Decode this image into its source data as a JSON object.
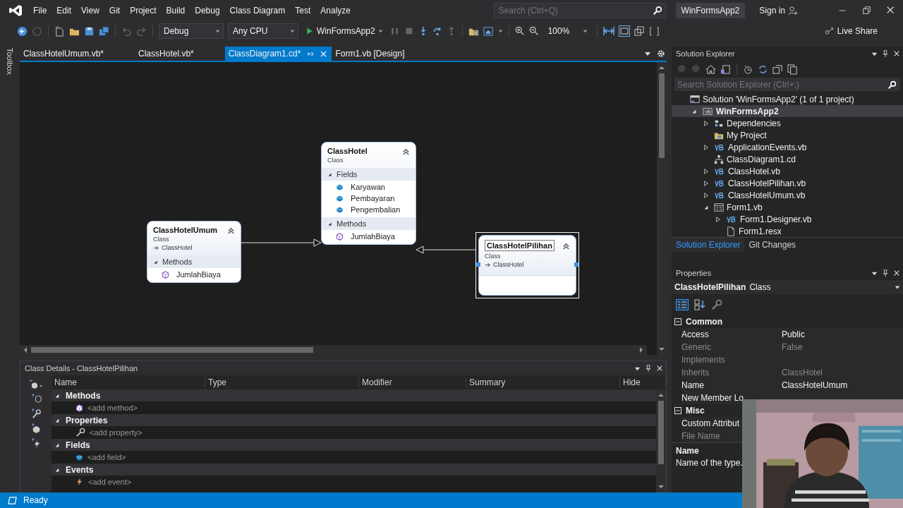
{
  "menu": [
    "File",
    "Edit",
    "View",
    "Git",
    "Project",
    "Build",
    "Debug",
    "Class Diagram",
    "Test",
    "Analyze"
  ],
  "search": {
    "placeholder": "Search (Ctrl+Q)"
  },
  "solution_name": "WinFormsApp2",
  "sign_in": "Sign in",
  "toolbar": {
    "configuration": "Debug",
    "platform": "Any CPU",
    "start_target": "WinFormsApp2",
    "zoom": "100%",
    "live_share": "Live Share"
  },
  "toolbox": "Toolbox",
  "tabs": [
    {
      "label": "ClassHotelUmum.vb*",
      "selected": false
    },
    {
      "label": "ClassHotel.vb*",
      "selected": false
    },
    {
      "label": "ClassDiagram1.cd*",
      "selected": true
    },
    {
      "label": "Form1.vb [Design]",
      "selected": false
    }
  ],
  "diagram": {
    "classes": [
      {
        "name": "ClassHotel",
        "stereotype": "Class",
        "selected": false,
        "compartments": [
          {
            "title": "Fields",
            "kind": "field",
            "expanded": true,
            "members": [
              "Karyawan",
              "Pembayaran",
              "Pengembalian"
            ]
          },
          {
            "title": "Methods",
            "kind": "method",
            "expanded": true,
            "members": [
              "JumlahBiaya"
            ]
          }
        ]
      },
      {
        "name": "ClassHotelUmum",
        "stereotype": "Class",
        "base": "ClassHotel",
        "selected": false,
        "compartments": [
          {
            "title": "Methods",
            "kind": "method",
            "expanded": true,
            "members": [
              "JumlahBiaya"
            ]
          }
        ]
      },
      {
        "name": "ClassHotelPilihan",
        "stereotype": "Class",
        "base": "ClassHotel",
        "selected": true
      }
    ]
  },
  "class_details": {
    "title": "Class Details - ClassHotelPilihan",
    "columns": [
      "Name",
      "Type",
      "Modifier",
      "Summary",
      "Hide"
    ],
    "groups": [
      {
        "title": "Methods",
        "kind": "method",
        "expanded": true,
        "add_row": "<add method>"
      },
      {
        "title": "Properties",
        "kind": "property",
        "expanded": true,
        "add_row": "<add property>"
      },
      {
        "title": "Fields",
        "kind": "field",
        "expanded": true,
        "add_row": "<add field>"
      },
      {
        "title": "Events",
        "kind": "event",
        "expanded": true,
        "add_row": "<add event>"
      }
    ]
  },
  "solution_explorer": {
    "title": "Solution Explorer",
    "search": {
      "placeholder": "Search Solution Explorer (Ctrl+;)"
    },
    "tree": [
      {
        "label": "Solution 'WinFormsApp2' (1 of 1 project)",
        "kind": "solution",
        "selected": false,
        "children": [
          {
            "label": "WinFormsApp2",
            "kind": "startup_project",
            "selected": true,
            "expanded": true,
            "children": [
              {
                "label": "Dependencies",
                "kind": "dependencies",
                "selected": false,
                "expanded": false
              },
              {
                "label": "My Project",
                "kind": "my_project",
                "selected": false
              },
              {
                "label": "ApplicationEvents.vb",
                "kind": "vb",
                "selected": false,
                "expanded": false
              },
              {
                "label": "ClassDiagram1.cd",
                "kind": "diagram",
                "selected": false
              },
              {
                "label": "ClassHotel.vb",
                "kind": "vb",
                "selected": false,
                "expanded": false
              },
              {
                "label": "ClassHotelPilihan.vb",
                "kind": "vb",
                "selected": false,
                "expanded": false
              },
              {
                "label": "ClassHotelUmum.vb",
                "kind": "vb",
                "selected": false,
                "expanded": false
              },
              {
                "label": "Form1.vb",
                "kind": "form",
                "selected": false,
                "expanded": true,
                "children": [
                  {
                    "label": "Form1.Designer.vb",
                    "kind": "vb",
                    "selected": false,
                    "expanded": false
                  },
                  {
                    "label": "Form1.resx",
                    "kind": "resource",
                    "selected": false
                  }
                ]
              }
            ]
          }
        ]
      }
    ]
  },
  "panel_tabs": [
    {
      "label": "Solution Explorer",
      "selected": true
    },
    {
      "label": "Git Changes",
      "selected": false
    }
  ],
  "properties": {
    "title": "Properties",
    "object": "ClassHotelPilihan",
    "object_type": "Class",
    "categories": [
      {
        "name": "Common",
        "expanded": true,
        "rows": [
          {
            "name": "Access",
            "value": "Public",
            "disabled": false
          },
          {
            "name": "Generic",
            "value": "False",
            "disabled": true
          },
          {
            "name": "Implements",
            "disabled": true
          },
          {
            "name": "Inherits",
            "value": "ClassHotel",
            "disabled": true
          },
          {
            "name": "Name",
            "value": "ClassHotelUmum",
            "disabled": false
          },
          {
            "name": "New Member Lo",
            "disabled": false
          }
        ]
      },
      {
        "name": "Misc",
        "expanded": true,
        "rows": [
          {
            "name": "Custom Attribut",
            "disabled": false
          },
          {
            "name": "File Name",
            "disabled": true
          }
        ]
      }
    ],
    "description": {
      "title": "Name",
      "text": "Name of the type."
    }
  },
  "status": "Ready"
}
